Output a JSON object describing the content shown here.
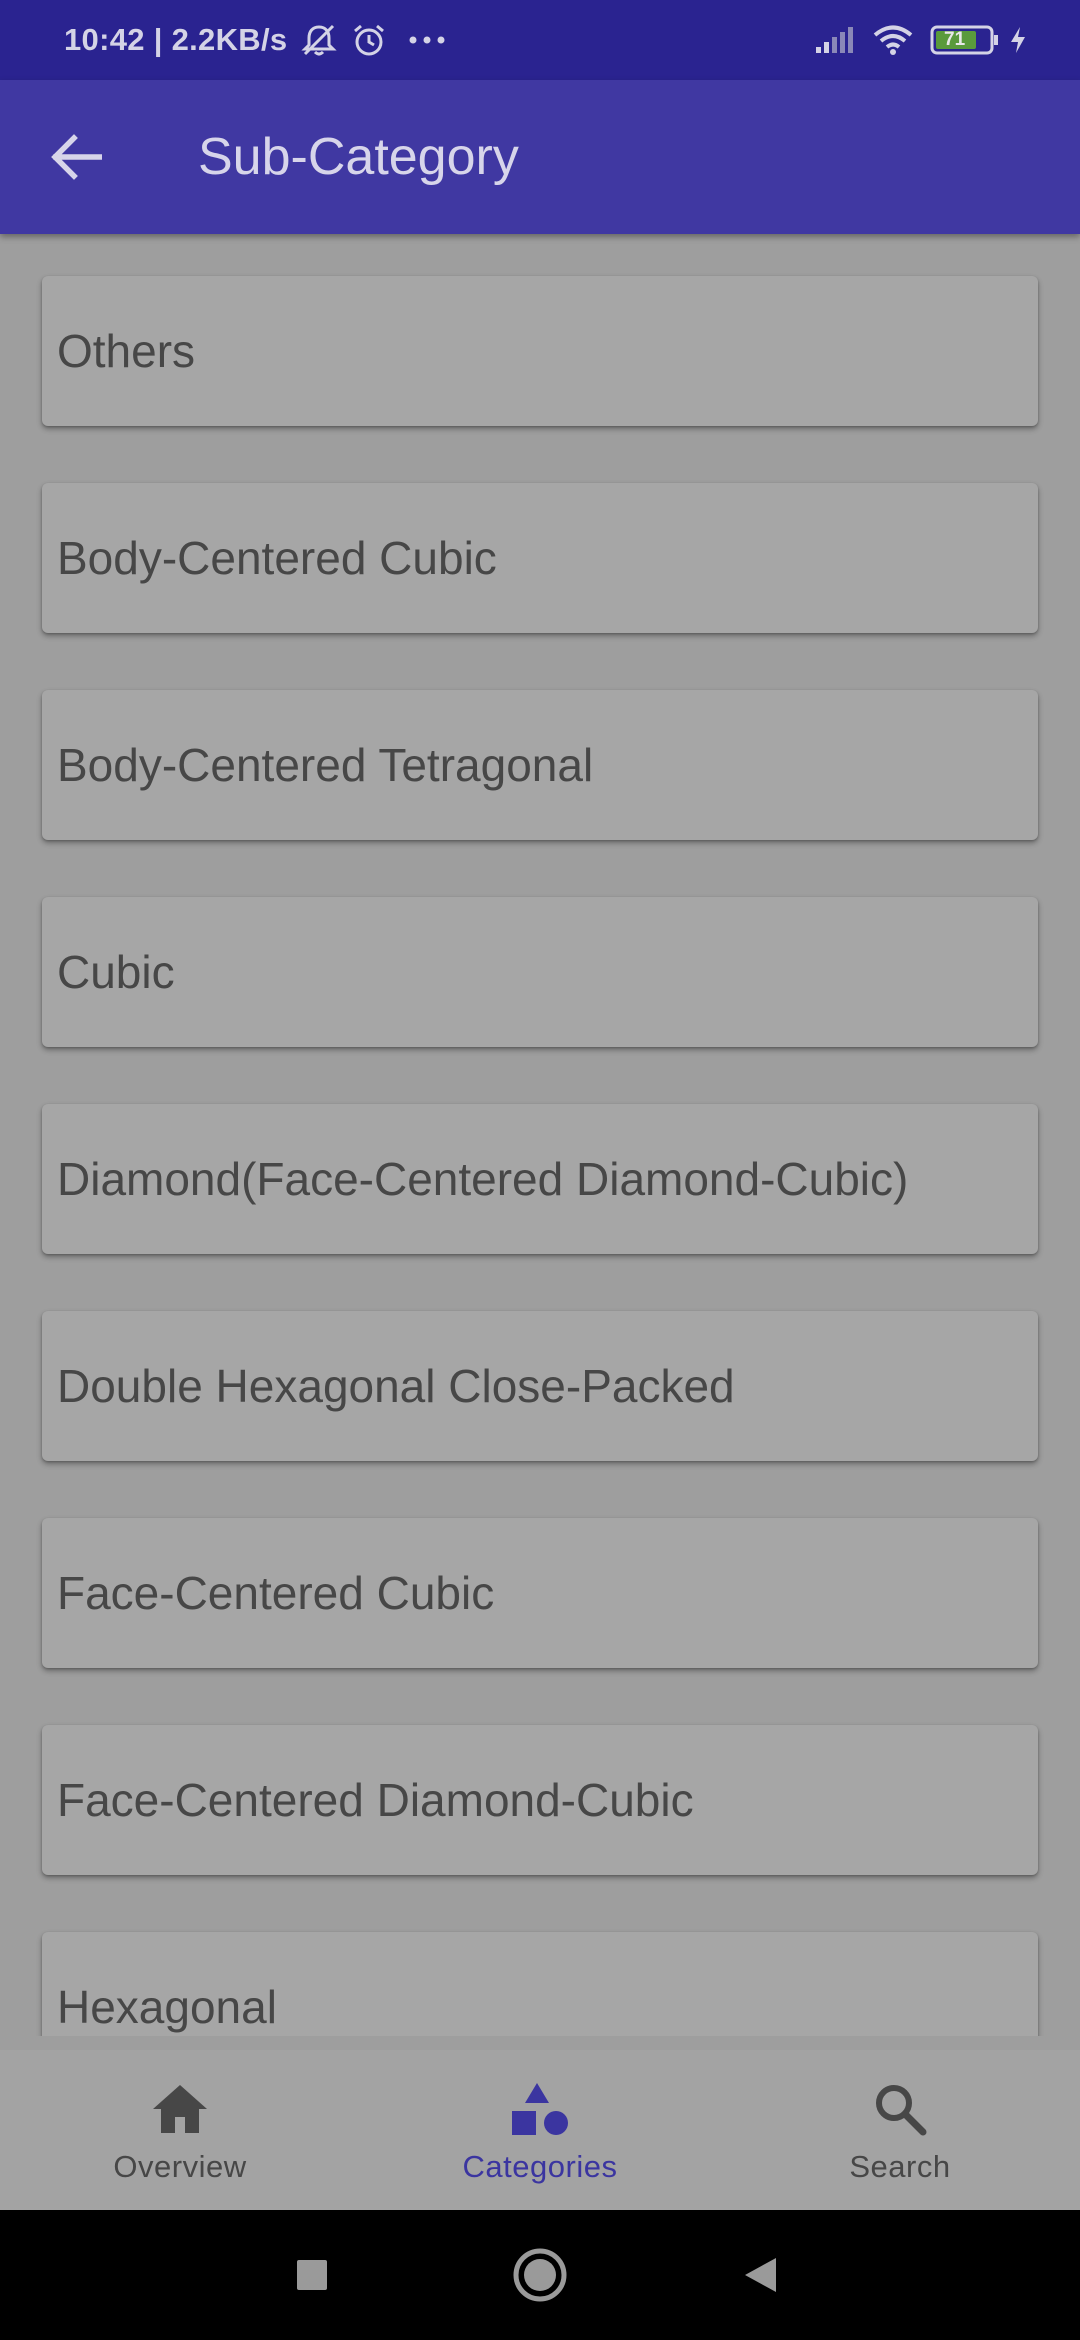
{
  "status_bar": {
    "time": "10:42 | 2.2KB/s",
    "battery": "71",
    "icons": [
      "mute-icon",
      "alarm-icon",
      "more-icon",
      "signal-icon",
      "wifi-icon",
      "battery-icon",
      "charging-icon"
    ]
  },
  "app_bar": {
    "title": "Sub-Category",
    "back_icon": "arrow-left-icon"
  },
  "subcategories": [
    "Others",
    "Body-Centered Cubic",
    "Body-Centered Tetragonal",
    "Cubic",
    "Diamond(Face-Centered Diamond-Cubic)",
    "Double Hexagonal Close-Packed",
    "Face-Centered Cubic",
    "Face-Centered Diamond-Cubic",
    "Hexagonal"
  ],
  "bottom_nav": {
    "items": [
      {
        "label": "Overview",
        "icon": "home-icon"
      },
      {
        "label": "Categories",
        "icon": "categories-icon",
        "active": true
      },
      {
        "label": "Search",
        "icon": "search-icon"
      }
    ]
  },
  "colors": {
    "status_bar": "#2a2390",
    "app_bar": "#4038a2",
    "background": "#9e9e9e",
    "card": "#a6a6a6",
    "active_tab": "#3b35a0"
  }
}
